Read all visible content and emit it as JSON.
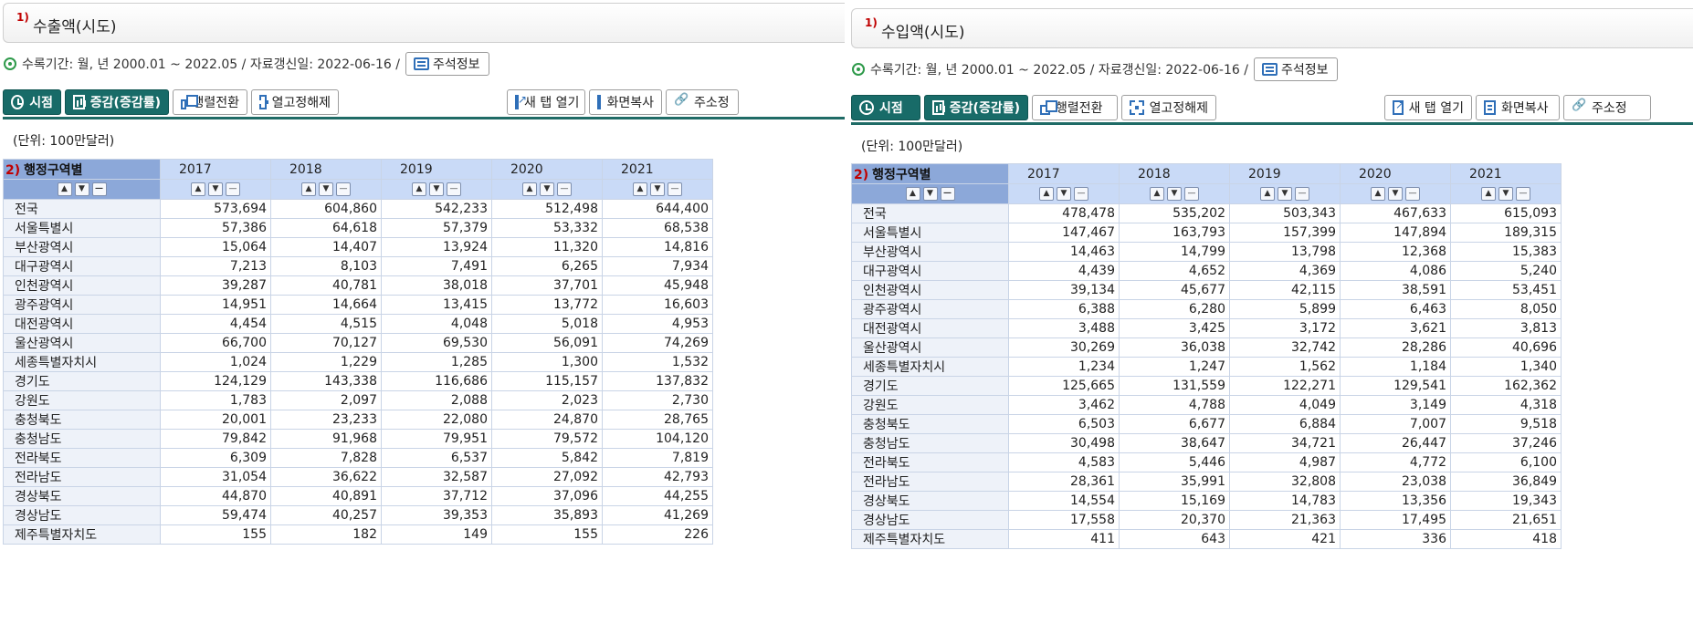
{
  "common": {
    "info_text": "수록기간: 월, 년 2000.01 ~ 2022.05 / 자료갱신일: 2022-06-16 /",
    "note_button": "주석정보",
    "unit": "(단위: 100만달러)",
    "corner_number": "2)",
    "corner_label": "행정구역별",
    "toolbar": {
      "time": "시점",
      "change": "증감(증감률)",
      "pivot": "행렬전환",
      "unfix": "열고정해제",
      "new_tab": "새 탭 열기",
      "copy": "화면복사",
      "address": "주소정"
    },
    "years": [
      "2017",
      "2018",
      "2019",
      "2020",
      "2021"
    ],
    "regions": [
      "전국",
      "서울특별시",
      "부산광역시",
      "대구광역시",
      "인천광역시",
      "광주광역시",
      "대전광역시",
      "울산광역시",
      "세종특별자치시",
      "경기도",
      "강원도",
      "충청북도",
      "충청남도",
      "전라북도",
      "전라남도",
      "경상북도",
      "경상남도",
      "제주특별자치도"
    ]
  },
  "export": {
    "title_number": "1)",
    "title": "수출액(시도)",
    "rows": [
      [
        "573,694",
        "604,860",
        "542,233",
        "512,498",
        "644,400"
      ],
      [
        "57,386",
        "64,618",
        "57,379",
        "53,332",
        "68,538"
      ],
      [
        "15,064",
        "14,407",
        "13,924",
        "11,320",
        "14,816"
      ],
      [
        "7,213",
        "8,103",
        "7,491",
        "6,265",
        "7,934"
      ],
      [
        "39,287",
        "40,781",
        "38,018",
        "37,701",
        "45,948"
      ],
      [
        "14,951",
        "14,664",
        "13,415",
        "13,772",
        "16,603"
      ],
      [
        "4,454",
        "4,515",
        "4,048",
        "5,018",
        "4,953"
      ],
      [
        "66,700",
        "70,127",
        "69,530",
        "56,091",
        "74,269"
      ],
      [
        "1,024",
        "1,229",
        "1,285",
        "1,300",
        "1,532"
      ],
      [
        "124,129",
        "143,338",
        "116,686",
        "115,157",
        "137,832"
      ],
      [
        "1,783",
        "2,097",
        "2,088",
        "2,023",
        "2,730"
      ],
      [
        "20,001",
        "23,233",
        "22,080",
        "24,870",
        "28,765"
      ],
      [
        "79,842",
        "91,968",
        "79,951",
        "79,572",
        "104,120"
      ],
      [
        "6,309",
        "7,828",
        "6,537",
        "5,842",
        "7,819"
      ],
      [
        "31,054",
        "36,622",
        "32,587",
        "27,092",
        "42,793"
      ],
      [
        "44,870",
        "40,891",
        "37,712",
        "37,096",
        "44,255"
      ],
      [
        "59,474",
        "40,257",
        "39,353",
        "35,893",
        "41,269"
      ],
      [
        "155",
        "182",
        "149",
        "155",
        "226"
      ]
    ]
  },
  "import": {
    "title_number": "1)",
    "title": "수입액(시도)",
    "rows": [
      [
        "478,478",
        "535,202",
        "503,343",
        "467,633",
        "615,093"
      ],
      [
        "147,467",
        "163,793",
        "157,399",
        "147,894",
        "189,315"
      ],
      [
        "14,463",
        "14,799",
        "13,798",
        "12,368",
        "15,383"
      ],
      [
        "4,439",
        "4,652",
        "4,369",
        "4,086",
        "5,240"
      ],
      [
        "39,134",
        "45,677",
        "42,115",
        "38,591",
        "53,451"
      ],
      [
        "6,388",
        "6,280",
        "5,899",
        "6,463",
        "8,050"
      ],
      [
        "3,488",
        "3,425",
        "3,172",
        "3,621",
        "3,813"
      ],
      [
        "30,269",
        "36,038",
        "32,742",
        "28,286",
        "40,696"
      ],
      [
        "1,234",
        "1,247",
        "1,562",
        "1,184",
        "1,340"
      ],
      [
        "125,665",
        "131,559",
        "122,271",
        "129,541",
        "162,362"
      ],
      [
        "3,462",
        "4,788",
        "4,049",
        "3,149",
        "4,318"
      ],
      [
        "6,503",
        "6,677",
        "6,884",
        "7,007",
        "9,518"
      ],
      [
        "30,498",
        "38,647",
        "34,721",
        "26,447",
        "37,246"
      ],
      [
        "4,583",
        "5,446",
        "4,987",
        "4,772",
        "6,100"
      ],
      [
        "28,361",
        "35,991",
        "32,808",
        "23,038",
        "36,849"
      ],
      [
        "14,554",
        "15,169",
        "14,783",
        "13,356",
        "19,343"
      ],
      [
        "17,558",
        "20,370",
        "21,363",
        "17,495",
        "21,651"
      ],
      [
        "411",
        "643",
        "421",
        "336",
        "418"
      ]
    ]
  }
}
